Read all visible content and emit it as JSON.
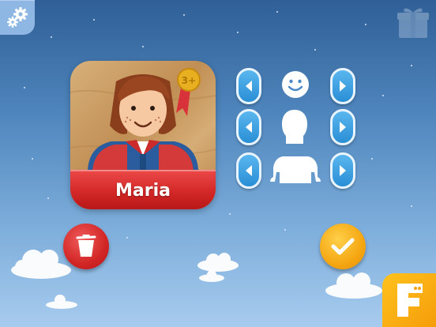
{
  "avatar": {
    "name": "Maria",
    "medal_text": "3+"
  },
  "customizer": {
    "rows": [
      {
        "part": "face",
        "prev_icon": "arrow-left-icon",
        "next_icon": "arrow-right-icon",
        "part_icon": "smiley-face-icon"
      },
      {
        "part": "hair",
        "prev_icon": "arrow-left-icon",
        "next_icon": "arrow-right-icon",
        "part_icon": "head-silhouette-icon"
      },
      {
        "part": "body",
        "prev_icon": "arrow-left-icon",
        "next_icon": "arrow-right-icon",
        "part_icon": "torso-silhouette-icon"
      }
    ]
  },
  "buttons": {
    "settings_icon": "gear-icon",
    "gift_icon": "gift-icon",
    "delete_icon": "trash-icon",
    "confirm_icon": "checkmark-icon",
    "app_badge_icon": "f-logo-icon"
  },
  "colors": {
    "banner_red": "#d42727",
    "arrow_blue": "#2a8fd6",
    "confirm_orange": "#f5a712",
    "delete_red": "#d22626"
  }
}
